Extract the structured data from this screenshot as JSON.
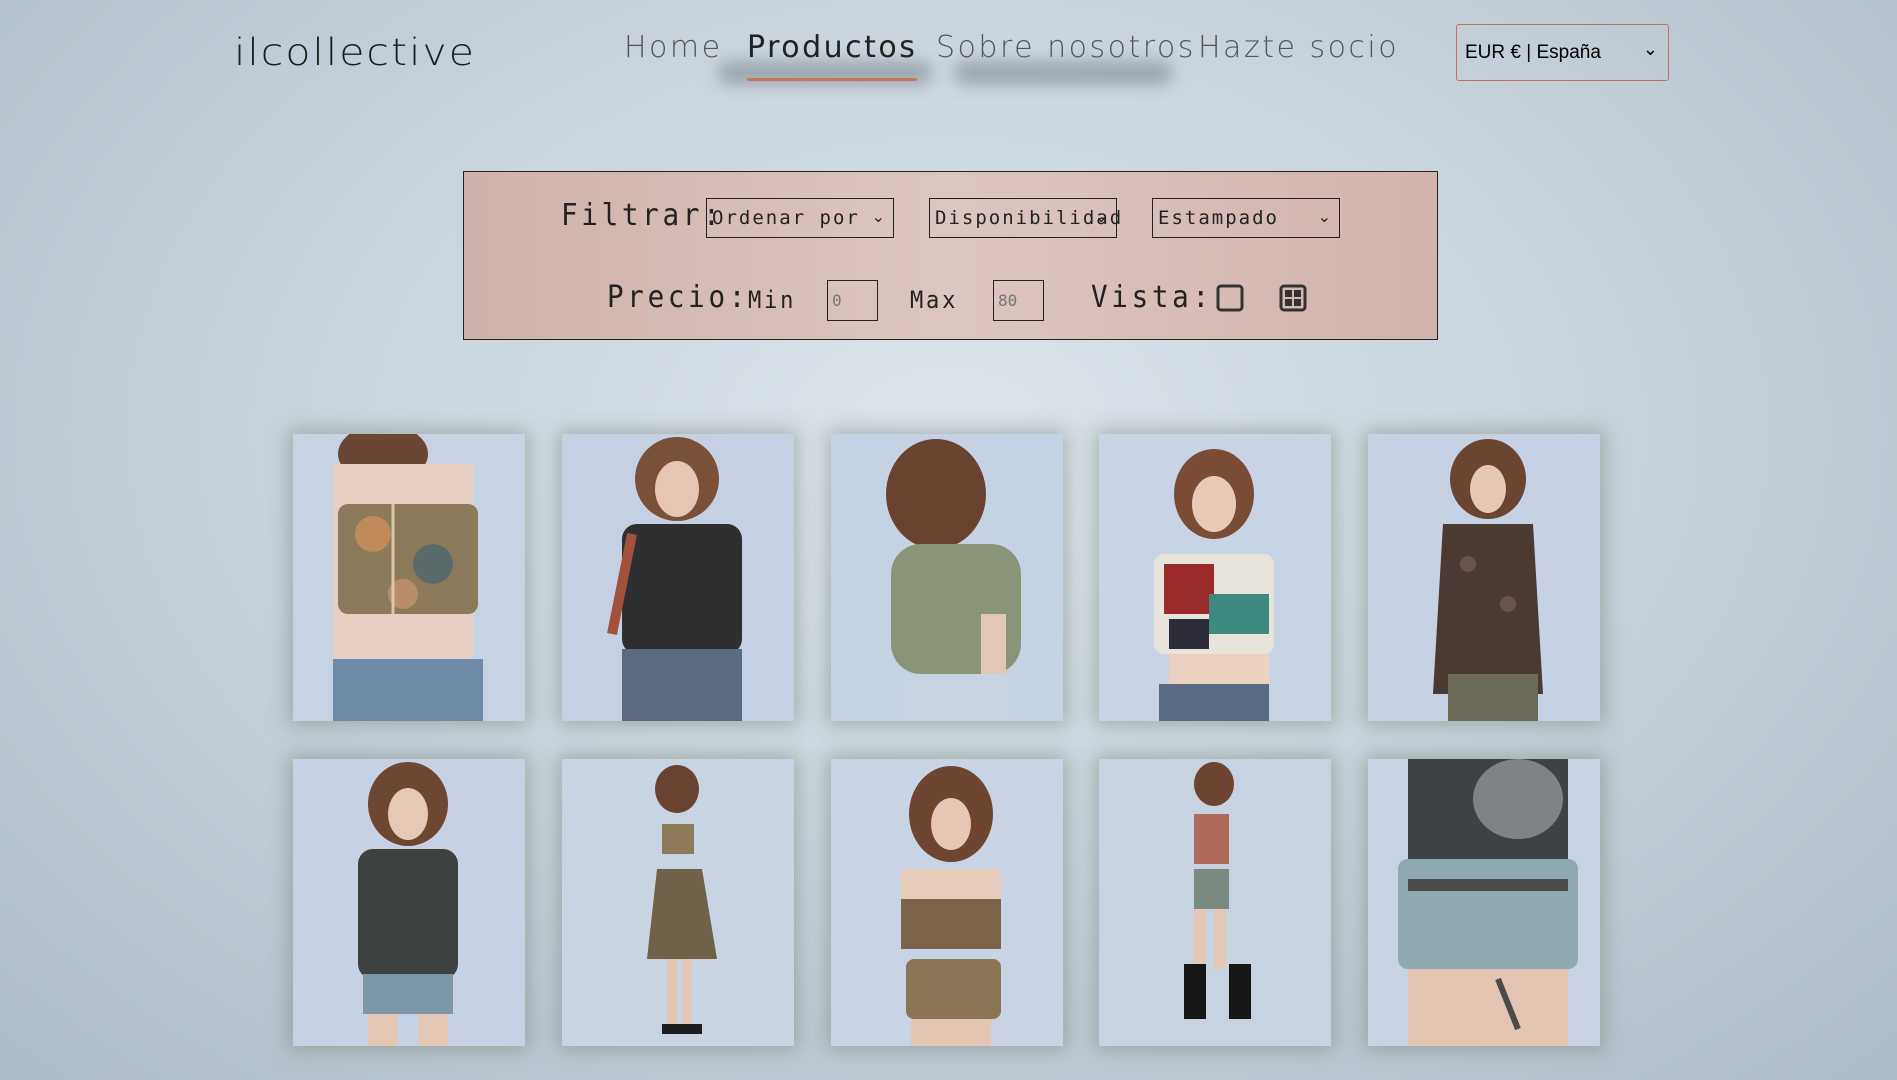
{
  "header": {
    "logo": "ilcollective",
    "nav": [
      {
        "label": "Home",
        "active": false
      },
      {
        "label": "Productos",
        "active": true
      },
      {
        "label": "Sobre nosotros",
        "active": false
      },
      {
        "label": "Hazte socio",
        "active": false
      }
    ],
    "currency": {
      "selected": "EUR € | España"
    }
  },
  "filters": {
    "filter_label": "Filtrar:",
    "sort": "Ordenar por",
    "availability": "Disponibilidad",
    "pattern": "Estampado",
    "price_label": "Precio:",
    "min_label": "Min",
    "max_label": "Max",
    "min_placeholder": "0",
    "max_placeholder": "80",
    "view_label": "Vista:",
    "view_icons": [
      "single-view-icon",
      "grid-view-icon"
    ]
  },
  "colors": {
    "accent": "#c9735a",
    "panel": "#d6bbb5",
    "background": "#c9d4dd"
  },
  "products": [
    {
      "image": "model-floral-corset-top"
    },
    {
      "image": "model-paisley-lace-up-top"
    },
    {
      "image": "model-green-fuzzy-knit-top"
    },
    {
      "image": "model-knit-crop-vest"
    },
    {
      "image": "model-crochet-cardigan"
    },
    {
      "image": "model-embellished-vest"
    },
    {
      "image": "model-floral-skirt-set"
    },
    {
      "image": "model-camisole-skirt-set"
    },
    {
      "image": "model-striped-top-boots"
    },
    {
      "image": "model-fur-vest-denim-shorts"
    }
  ]
}
